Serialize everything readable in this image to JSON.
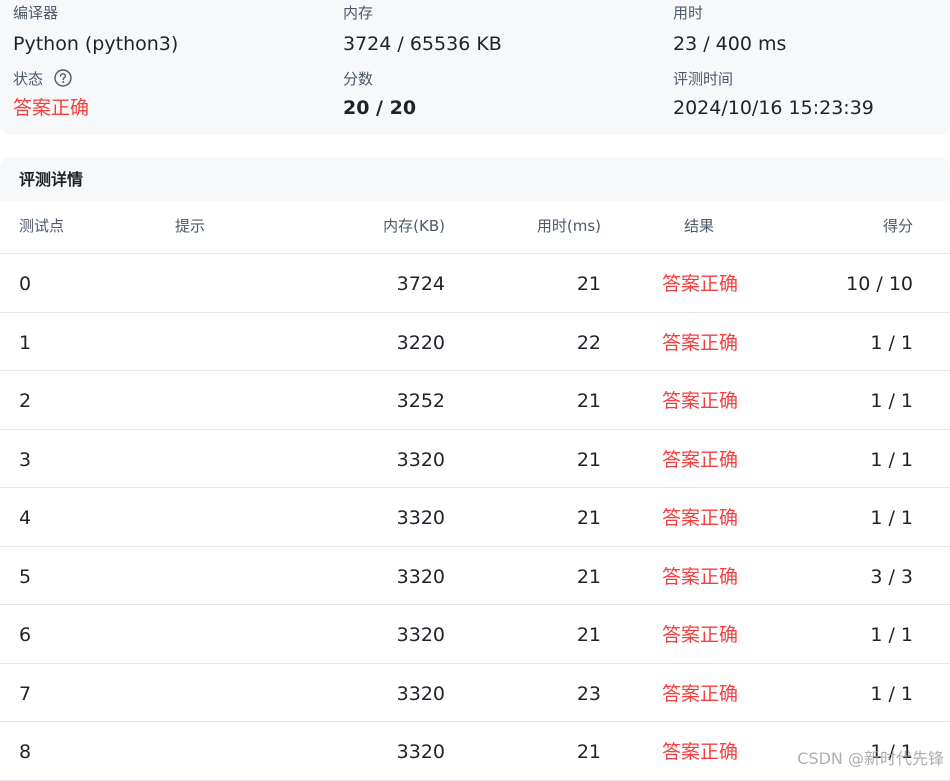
{
  "summary": {
    "compiler_label": "编译器",
    "compiler_value": "Python (python3)",
    "memory_label": "内存",
    "memory_value": "3724 / 65536 KB",
    "time_label": "用时",
    "time_value": "23 / 400 ms",
    "status_label": "状态",
    "status_value": "答案正确",
    "score_label": "分数",
    "score_value": "20 / 20",
    "judge_time_label": "评测时间",
    "judge_time_value": "2024/10/16 15:23:39",
    "help_icon": "question-circle-icon"
  },
  "details": {
    "title": "评测详情",
    "columns": {
      "id": "测试点",
      "hint": "提示",
      "memory": "内存(KB)",
      "time": "用时(ms)",
      "result": "结果",
      "score": "得分"
    },
    "rows": [
      {
        "id": "0",
        "hint": "",
        "memory": "3724",
        "time": "21",
        "result": "答案正确",
        "score": "10 / 10"
      },
      {
        "id": "1",
        "hint": "",
        "memory": "3220",
        "time": "22",
        "result": "答案正确",
        "score": "1 / 1"
      },
      {
        "id": "2",
        "hint": "",
        "memory": "3252",
        "time": "21",
        "result": "答案正确",
        "score": "1 / 1"
      },
      {
        "id": "3",
        "hint": "",
        "memory": "3320",
        "time": "21",
        "result": "答案正确",
        "score": "1 / 1"
      },
      {
        "id": "4",
        "hint": "",
        "memory": "3320",
        "time": "21",
        "result": "答案正确",
        "score": "1 / 1"
      },
      {
        "id": "5",
        "hint": "",
        "memory": "3320",
        "time": "21",
        "result": "答案正确",
        "score": "3 / 3"
      },
      {
        "id": "6",
        "hint": "",
        "memory": "3320",
        "time": "21",
        "result": "答案正确",
        "score": "1 / 1"
      },
      {
        "id": "7",
        "hint": "",
        "memory": "3320",
        "time": "23",
        "result": "答案正确",
        "score": "1 / 1"
      },
      {
        "id": "8",
        "hint": "",
        "memory": "3320",
        "time": "21",
        "result": "答案正确",
        "score": "1 / 1"
      }
    ]
  },
  "watermark": "CSDN @新时代先锋",
  "colors": {
    "accepted": "#f53f3f",
    "panel_bg": "#f7f8fa",
    "divider": "#e5e6eb"
  }
}
